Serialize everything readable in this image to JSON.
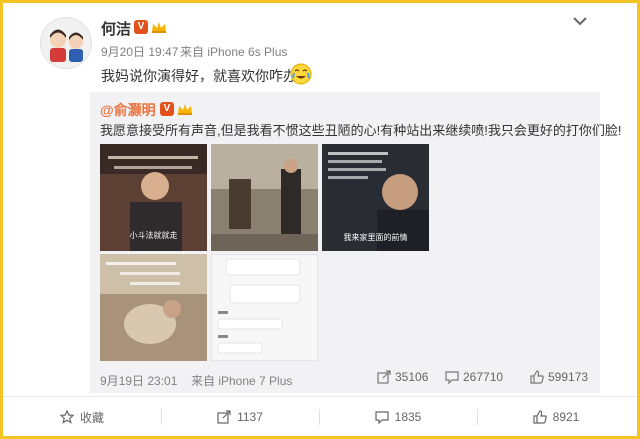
{
  "post": {
    "username": "何洁",
    "time": "9月20日 19:47",
    "source": "来自 iPhone 6s Plus",
    "text": "我妈说你演得好，就喜欢你咋办"
  },
  "repost": {
    "username": "@俞灏明",
    "text": "我愿意接受所有声音,但是我看不惯这些丑陋的心!有种站出来继续喷!我只会更好的打你们脸!",
    "time": "9月19日 23:01",
    "source": "来自 iPhone 7 Plus",
    "reposts": "35106",
    "comments": "267710",
    "likes": "599173",
    "thumb_captions": [
      "小斗法就就走",
      "",
      "我来家里面的前情"
    ]
  },
  "actions": {
    "favorite": "收藏",
    "repost": "1137",
    "comment": "1835",
    "like": "8921"
  },
  "colors": {
    "border": "#f4c425",
    "accent": "#eb7340",
    "v_badge": "#e2511c"
  }
}
